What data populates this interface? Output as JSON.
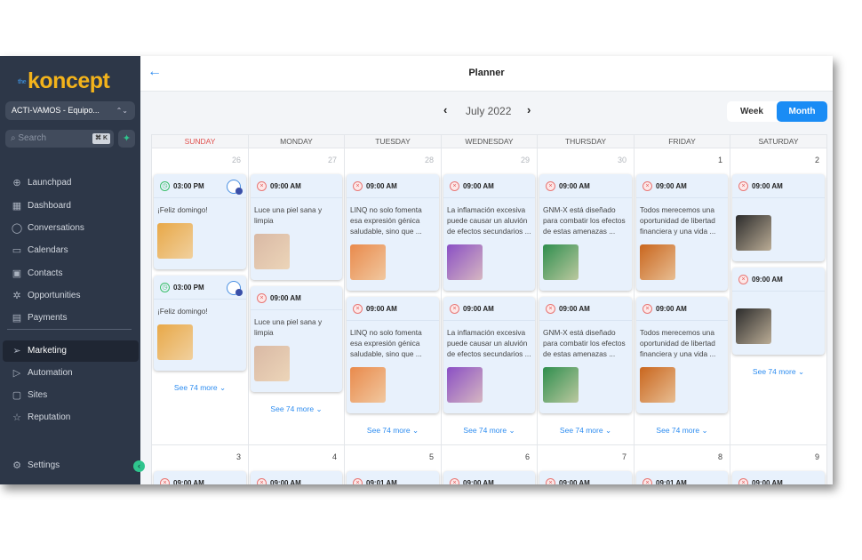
{
  "sidebar": {
    "logo": "koncept",
    "logo_prefix": "the",
    "account": "ACTI-VAMOS - Equipo...",
    "search_placeholder": "Search",
    "search_shortcut": "⌘ K",
    "items": [
      {
        "label": "Launchpad",
        "icon": "launchpad-icon"
      },
      {
        "label": "Dashboard",
        "icon": "dashboard-icon"
      },
      {
        "label": "Conversations",
        "icon": "chat-icon"
      },
      {
        "label": "Calendars",
        "icon": "calendar-icon"
      },
      {
        "label": "Contacts",
        "icon": "contacts-icon"
      },
      {
        "label": "Opportunities",
        "icon": "opportunities-icon"
      },
      {
        "label": "Payments",
        "icon": "payments-icon"
      }
    ],
    "items2": [
      {
        "label": "Marketing",
        "icon": "send-icon",
        "active": true
      },
      {
        "label": "Automation",
        "icon": "automation-icon"
      },
      {
        "label": "Sites",
        "icon": "sites-icon"
      },
      {
        "label": "Reputation",
        "icon": "star-icon"
      }
    ],
    "settings": "Settings"
  },
  "header": {
    "title": "Planner",
    "month": "July 2022",
    "week": "Week",
    "month_view": "Month"
  },
  "colors": {
    "accent": "#1a8cf5",
    "sidebar": "#2d3748",
    "card": "#e8f1fc",
    "error": "#e05555",
    "success": "#3cbf6b"
  },
  "days": [
    "SUNDAY",
    "MONDAY",
    "TUESDAY",
    "WEDNESDAY",
    "THURSDAY",
    "FRIDAY",
    "SATURDAY"
  ],
  "weeks": [
    {
      "dates": [
        {
          "n": "26",
          "dim": true
        },
        {
          "n": "27",
          "dim": true
        },
        {
          "n": "28",
          "dim": true
        },
        {
          "n": "29",
          "dim": true
        },
        {
          "n": "30",
          "dim": true
        },
        {
          "n": "1"
        },
        {
          "n": "2"
        }
      ],
      "cells": [
        {
          "more": "See 74 more",
          "cards": [
            {
              "time": "03:00 PM",
              "status": "ok",
              "fb": true,
              "text": "¡Feliz domingo!",
              "thumb": "#e8a848"
            },
            {
              "time": "03:00 PM",
              "status": "ok",
              "fb": true,
              "text": "¡Feliz domingo!",
              "thumb": "#e8a848"
            }
          ]
        },
        {
          "more": "See 74 more",
          "cards": [
            {
              "time": "09:00 AM",
              "status": "err",
              "text": "Luce una piel sana y limpia",
              "thumb": "#d9b9a5"
            },
            {
              "time": "09:00 AM",
              "status": "err",
              "text": "Luce una piel sana y limpia",
              "thumb": "#d9b9a5"
            }
          ]
        },
        {
          "more": "See 74 more",
          "cards": [
            {
              "time": "09:00 AM",
              "status": "err",
              "text": "LINQ no solo fomenta esa expresión génica saludable, sino que ...",
              "thumb": "#e98a4c"
            },
            {
              "time": "09:00 AM",
              "status": "err",
              "text": "LINQ no solo fomenta esa expresión génica saludable, sino que ...",
              "thumb": "#e98a4c"
            }
          ]
        },
        {
          "more": "See 74 more",
          "cards": [
            {
              "time": "09:00 AM",
              "status": "err",
              "text": "La inflamación excesiva puede causar un aluvión de efectos secundarios ...",
              "thumb": "#8a4fc4"
            },
            {
              "time": "09:00 AM",
              "status": "err",
              "text": "La inflamación excesiva puede causar un aluvión de efectos secundarios ...",
              "thumb": "#8a4fc4"
            }
          ]
        },
        {
          "more": "See 74 more",
          "cards": [
            {
              "time": "09:00 AM",
              "status": "err",
              "text": "GNM-X está diseñado para combatir los efectos de estas amenazas ...",
              "thumb": "#2f8e4e"
            },
            {
              "time": "09:00 AM",
              "status": "err",
              "text": "GNM-X está diseñado para combatir los efectos de estas amenazas ...",
              "thumb": "#2f8e4e"
            }
          ]
        },
        {
          "more": "See 74 more",
          "cards": [
            {
              "time": "09:00 AM",
              "status": "err",
              "text": "Todos merecemos una oportunidad de libertad financiera y una vida ...",
              "thumb": "#c9661e"
            },
            {
              "time": "09:00 AM",
              "status": "err",
              "text": "Todos merecemos una oportunidad de libertad financiera y una vida ...",
              "thumb": "#c9661e"
            }
          ]
        },
        {
          "more": "See 74 more",
          "cards": [
            {
              "time": "09:00 AM",
              "status": "err",
              "text": "",
              "thumb": "#2b2b2b"
            },
            {
              "time": "09:00 AM",
              "status": "err",
              "text": "",
              "thumb": "#2b2b2b"
            }
          ]
        }
      ]
    },
    {
      "dates": [
        {
          "n": "3"
        },
        {
          "n": "4"
        },
        {
          "n": "5"
        },
        {
          "n": "6"
        },
        {
          "n": "7"
        },
        {
          "n": "8"
        },
        {
          "n": "9"
        }
      ],
      "cells": [
        {
          "cards": [
            {
              "time": "09:00 AM",
              "status": "err"
            }
          ]
        },
        {
          "cards": [
            {
              "time": "09:00 AM",
              "status": "err"
            }
          ]
        },
        {
          "cards": [
            {
              "time": "09:01 AM",
              "status": "err"
            }
          ]
        },
        {
          "cards": [
            {
              "time": "09:00 AM",
              "status": "err"
            }
          ]
        },
        {
          "cards": [
            {
              "time": "09:00 AM",
              "status": "err"
            }
          ]
        },
        {
          "cards": [
            {
              "time": "09:01 AM",
              "status": "err"
            }
          ]
        },
        {
          "cards": [
            {
              "time": "09:00 AM",
              "status": "err"
            }
          ]
        }
      ]
    }
  ]
}
